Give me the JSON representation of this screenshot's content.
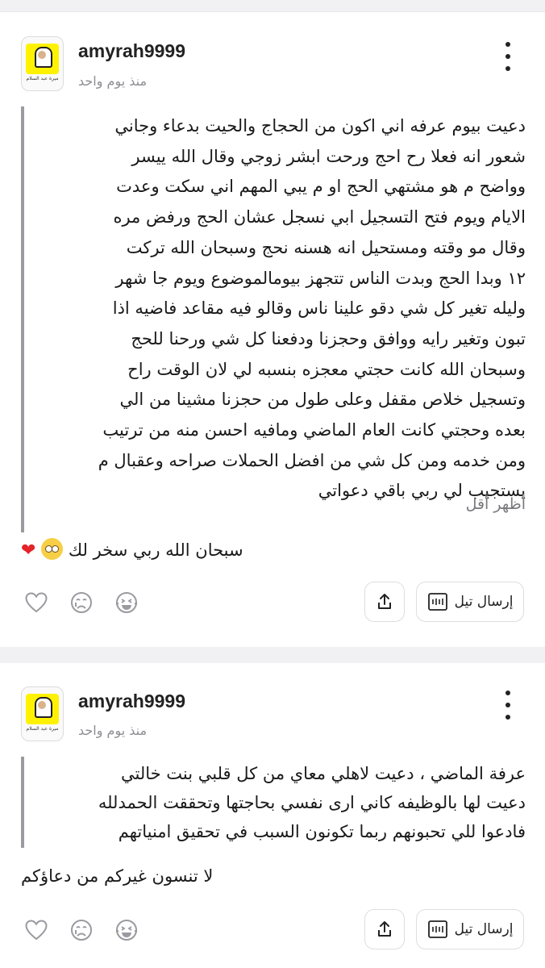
{
  "posts": [
    {
      "username": "amyrah9999",
      "time_ago": "منذ يوم واحد",
      "avatar_caption": "ميرة عبد السلام",
      "avatar_caption2": "",
      "body": "دعيت بيوم عرفه اني اكون من الحجاج والحيت بدعاء وجاني\nشعور انه فعلا رح احج ورحت ابشر زوجي وقال الله ييسر\nوواضح م هو مشتهي الحج او م يبي المهم اني سكت وعدت\nالايام ويوم فتح التسجيل ابي نسجل عشان الحج ورفض مره\nوقال مو وقته ومستحيل انه هسنه نحج وسبحان الله تركت\n١٢ وبدا الحج وبدت الناس تتجهز بيومالموضوع ويوم جا شهر\nوليله تغير كل شي دقو علينا ناس وقالو فيه مقاعد فاضيه اذا\nتبون وتغير رايه ووافق وحجزنا ودفعنا كل شي ورحنا للحج\nوسبحان الله كانت حجتي معجزه بنسبه لي لان الوقت راح\nوتسجيل خلاص مقفل وعلى طول من حجزنا مشينا من الي\nبعده وحجتي كانت العام الماضي ومافيه احسن منه من ترتيب\nومن خدمه ومن كل شي من افضل الحملات صراحه وعقبال م\nيستجيب لي ربي باقي دعواتي",
      "show_less": "أظهر أقل",
      "comment": "سبحان الله ربي سخر لك",
      "send_label": "إرسال تيل"
    },
    {
      "username": "amyrah9999",
      "time_ago": "منذ يوم واحد",
      "avatar_caption": "ميرة عبد السلام",
      "body": "عرفة الماضي ، دعيت لاهلي معاي من كل قلبي بنت خالتي\nدعيت لها بالوظيفه كاني ارى  نفسي بحاجتها وتحققت الحمدلله\nفادعوا للي تحبونهم ربما تكونون السبب في تحقيق امنياتهم",
      "comment": "لا تنسون غيركم من دعاؤكم",
      "send_label": "إرسال تيل"
    }
  ],
  "icons": {
    "more": "more-vertical-icon",
    "heart": "heart-outline-icon",
    "sad": "crying-face-icon",
    "laugh": "laughing-face-icon",
    "share": "share-upload-icon",
    "send": "tell-message-icon"
  },
  "colors": {
    "separator": "#f1f1f3",
    "quote_bar": "#9a9aa0",
    "muted_text": "#8e8e93",
    "heart_red": "#e3242b"
  }
}
